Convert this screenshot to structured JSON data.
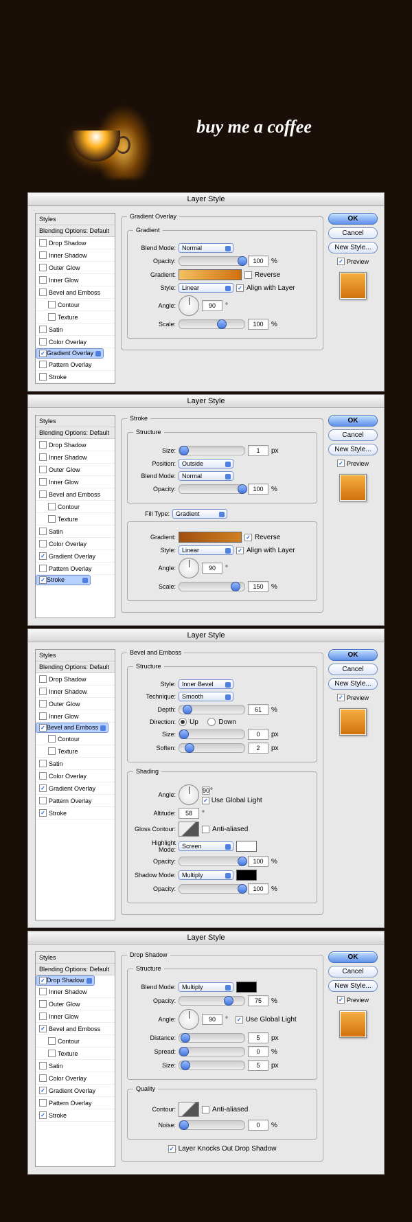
{
  "hero": {
    "text": "buy me a coffee"
  },
  "dialog_title": "Layer Style",
  "sidebar": {
    "header": "Styles",
    "blending": "Blending Options: Default",
    "items": [
      "Drop Shadow",
      "Inner Shadow",
      "Outer Glow",
      "Inner Glow",
      "Bevel and Emboss",
      "Contour",
      "Texture",
      "Satin",
      "Color Overlay",
      "Gradient Overlay",
      "Pattern Overlay",
      "Stroke"
    ]
  },
  "actions": {
    "ok": "OK",
    "cancel": "Cancel",
    "newstyle": "New Style...",
    "preview": "Preview"
  },
  "common": {
    "blendmode": "Blend Mode:",
    "opacity": "Opacity:",
    "angle": "Angle:",
    "scale": "Scale:",
    "size": "Size:",
    "style": "Style:",
    "gradient": "Gradient:",
    "reverse": "Reverse",
    "alignlayer": "Align with Layer",
    "normal": "Normal",
    "linear": "Linear",
    "pct": "%",
    "px": "px",
    "deg": "°"
  },
  "d1": {
    "title": "Gradient Overlay",
    "group": "Gradient",
    "opacity": "100",
    "angle": "90",
    "scale": "100",
    "checked": [
      "Gradient Overlay"
    ],
    "selected": "Gradient Overlay"
  },
  "d2": {
    "title": "Stroke",
    "g1": "Structure",
    "size": "1",
    "position": "Position:",
    "outside": "Outside",
    "opacity": "100",
    "filltype": "Fill Type:",
    "gradient_v": "Gradient",
    "angle": "90",
    "scale": "150",
    "checked": [
      "Gradient Overlay",
      "Stroke"
    ],
    "selected": "Stroke"
  },
  "d3": {
    "title": "Bevel and Emboss",
    "g1": "Structure",
    "g2": "Shading",
    "style_v": "Inner Bevel",
    "technique": "Technique:",
    "smooth": "Smooth",
    "depth": "Depth:",
    "depth_v": "61",
    "direction": "Direction:",
    "up": "Up",
    "down": "Down",
    "size_v": "0",
    "soften": "Soften:",
    "soften_v": "2",
    "angle": "90",
    "globallight": "Use Global Light",
    "altitude": "Altitude:",
    "altitude_v": "58",
    "glosscontour": "Gloss Contour:",
    "antialiased": "Anti-aliased",
    "highlight": "Highlight Mode:",
    "screen": "Screen",
    "h_opacity": "100",
    "shadowmode": "Shadow Mode:",
    "multiply": "Multiply",
    "s_opacity": "100",
    "checked": [
      "Bevel and Emboss",
      "Gradient Overlay",
      "Stroke"
    ],
    "selected": "Bevel and Emboss"
  },
  "d4": {
    "title": "Drop Shadow",
    "g1": "Structure",
    "g2": "Quality",
    "multiply": "Multiply",
    "opacity": "75",
    "angle": "90",
    "globallight": "Use Global Light",
    "distance": "Distance:",
    "distance_v": "5",
    "spread": "Spread:",
    "spread_v": "0",
    "size_v": "5",
    "contour": "Contour:",
    "antialiased": "Anti-aliased",
    "noise": "Noise:",
    "noise_v": "0",
    "knockout": "Layer Knocks Out Drop Shadow",
    "checked": [
      "Drop Shadow",
      "Bevel and Emboss",
      "Gradient Overlay",
      "Stroke"
    ],
    "selected": "Drop Shadow"
  }
}
